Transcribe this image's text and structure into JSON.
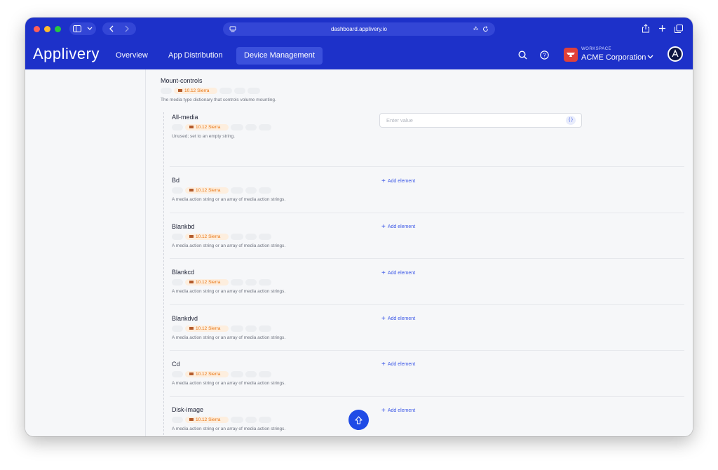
{
  "browser": {
    "url": "dashboard.applivery.io"
  },
  "app": {
    "logo": "Applivery",
    "nav": [
      "Overview",
      "App Distribution",
      "Device Management"
    ],
    "active_nav": "Device Management",
    "workspace_label": "WORKSPACE",
    "workspace_name": "ACME Corporation",
    "colors": {
      "brand": "#1d31c9",
      "accent": "#3b57e6",
      "badge_orange": "#e8730f"
    }
  },
  "section": {
    "title": "Mount-controls",
    "os_badge": "10.12 Sierra",
    "description": "The media type dictionary that controls volume mounting."
  },
  "items": [
    {
      "name": "All-media",
      "os_badge": "10.12 Sierra",
      "description": "Unused; set to an empty string.",
      "input_placeholder": "Enter value",
      "input_icon": "{ }"
    },
    {
      "name": "Bd",
      "os_badge": "10.12 Sierra",
      "description": "A media action string or an array of media action strings.",
      "action": "Add element"
    },
    {
      "name": "Blankbd",
      "os_badge": "10.12 Sierra",
      "description": "A media action string or an array of media action strings.",
      "action": "Add element"
    },
    {
      "name": "Blankcd",
      "os_badge": "10.12 Sierra",
      "description": "A media action string or an array of media action strings.",
      "action": "Add element"
    },
    {
      "name": "Blankdvd",
      "os_badge": "10.12 Sierra",
      "description": "A media action string or an array of media action strings.",
      "action": "Add element"
    },
    {
      "name": "Cd",
      "os_badge": "10.12 Sierra",
      "description": "A media action string or an array of media action strings.",
      "action": "Add element"
    },
    {
      "name": "Disk-image",
      "os_badge": "10.12 Sierra",
      "description": "A media action string or an array of media action strings.",
      "action": "Add element"
    }
  ]
}
